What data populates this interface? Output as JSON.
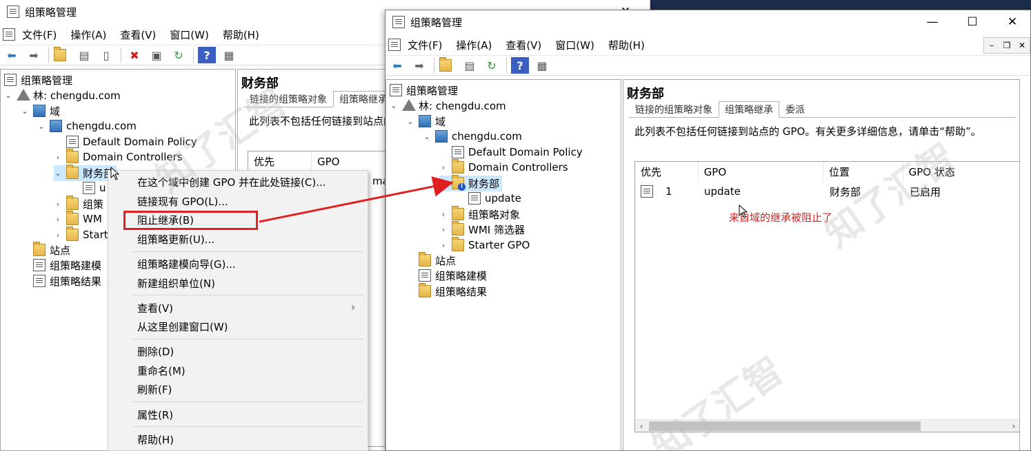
{
  "colors": {
    "annotation_red": "#e02020",
    "dark_desktop": "#1b2b4b"
  },
  "window_back": {
    "title": "组策略管理",
    "controls": [
      "—",
      "✕"
    ],
    "menu": [
      "文件(F)",
      "操作(A)",
      "查看(V)",
      "窗口(W)",
      "帮助(H)"
    ],
    "tree_root": "组策略管理",
    "tree": {
      "forest": "林: chengdu.com",
      "domain_folder": "域",
      "domain": "chengdu.com",
      "default_policy": "Default Domain Policy",
      "domain_controllers": "Domain Controllers",
      "ou_finance": "财务部",
      "ou_child_trunc": "u",
      "gpo_objects_trunc": "组策",
      "wmi_trunc": "WM",
      "starter_trunc": "Start",
      "sites": "站点",
      "modeling_trunc": "组策略建模",
      "results": "组策略结果"
    },
    "right_header": "财务部",
    "tabs": [
      "链接的组策略对象",
      "组策略继承"
    ],
    "info": "此列表不包括任何链接到站点的",
    "columns": [
      "优先",
      "GPO"
    ],
    "partial_cell": "ma"
  },
  "context_menu": {
    "items": [
      "在这个域中创建 GPO 并在此处链接(C)...",
      "链接现有 GPO(L)...",
      "阻止继承(B)",
      "组策略更新(U)...",
      "组策略建模向导(G)...",
      "新建组织单位(N)",
      "查看(V)",
      "从这里创建窗口(W)",
      "删除(D)",
      "重命名(M)",
      "刷新(F)",
      "属性(R)",
      "帮助(H)"
    ],
    "submenu_arrow": "›"
  },
  "window_front": {
    "title": "组策略管理",
    "controls": [
      "—",
      "☐",
      "✕"
    ],
    "menu": [
      "文件(F)",
      "操作(A)",
      "查看(V)",
      "窗口(W)",
      "帮助(H)"
    ],
    "mdi_controls": [
      "–",
      "❐",
      "✕"
    ],
    "tree_root": "组策略管理",
    "tree": {
      "forest": "林: chengdu.com",
      "domain_folder": "域",
      "domain": "chengdu.com",
      "default_policy": "Default Domain Policy",
      "domain_controllers": "Domain Controllers",
      "ou_finance": "财务部",
      "ou_child": "update",
      "gpo_objects": "组策略对象",
      "wmi": "WMI 筛选器",
      "starter": "Starter GPO",
      "sites": "站点",
      "modeling": "组策略建模",
      "results": "组策略结果"
    },
    "right_header": "财务部",
    "tabs": [
      "链接的组策略对象",
      "组策略继承",
      "委派"
    ],
    "active_tab": "组策略继承",
    "info": "此列表不包括任何链接到站点的 GPO。有关更多详细信息，请单击“帮助”。",
    "columns": [
      "优先",
      "GPO",
      "位置",
      "GPO 状态"
    ],
    "rows": [
      {
        "priority": "1",
        "gpo": "update",
        "location": "财务部",
        "status": "已启用"
      }
    ],
    "scroll_left": "‹",
    "scroll_right": "›"
  },
  "annotation_text": "来自域的继承被阻止了",
  "watermark": "知了汇智"
}
